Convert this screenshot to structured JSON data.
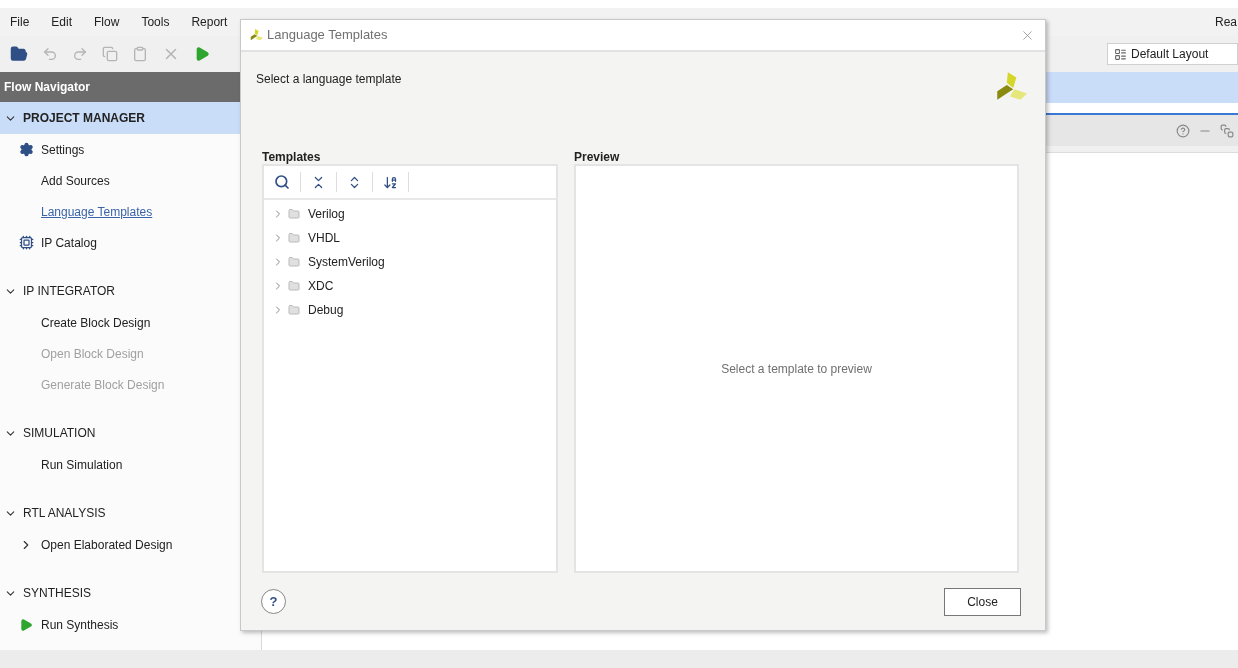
{
  "menu": [
    "File",
    "Edit",
    "Flow",
    "Tools",
    "Report"
  ],
  "top_right_text": "Rea",
  "layout_select": {
    "value": "Default Layout"
  },
  "navigator": {
    "title": "Flow Navigator",
    "sections": [
      {
        "title": "PROJECT MANAGER",
        "expanded": true,
        "selected": true,
        "items": [
          {
            "label": "Settings",
            "kind": "gear",
            "disabled": false
          },
          {
            "label": "Add Sources",
            "kind": "plain",
            "disabled": false
          },
          {
            "label": "Language Templates",
            "kind": "link",
            "disabled": false
          },
          {
            "label": "IP Catalog",
            "kind": "chip",
            "disabled": false
          }
        ]
      },
      {
        "title": "IP INTEGRATOR",
        "expanded": true,
        "selected": false,
        "items": [
          {
            "label": "Create Block Design",
            "kind": "plain",
            "disabled": false
          },
          {
            "label": "Open Block Design",
            "kind": "plain",
            "disabled": true
          },
          {
            "label": "Generate Block Design",
            "kind": "plain",
            "disabled": true
          }
        ]
      },
      {
        "title": "SIMULATION",
        "expanded": true,
        "selected": false,
        "items": [
          {
            "label": "Run Simulation",
            "kind": "plain",
            "disabled": false
          }
        ]
      },
      {
        "title": "RTL ANALYSIS",
        "expanded": true,
        "selected": false,
        "items": [
          {
            "label": "Open Elaborated Design",
            "kind": "expandable",
            "disabled": false
          }
        ]
      },
      {
        "title": "SYNTHESIS",
        "expanded": true,
        "selected": false,
        "items": [
          {
            "label": "Run Synthesis",
            "kind": "play",
            "disabled": false
          }
        ]
      }
    ]
  },
  "dialog": {
    "title": "Language Templates",
    "subtitle": "Select a language template",
    "templates": {
      "label": "Templates",
      "items": [
        {
          "label": "Verilog",
          "expanded": false
        },
        {
          "label": "VHDL",
          "expanded": false
        },
        {
          "label": "SystemVerilog",
          "expanded": false
        },
        {
          "label": "XDC",
          "expanded": false
        },
        {
          "label": "Debug",
          "expanded": false
        }
      ]
    },
    "preview": {
      "label": "Preview",
      "message": "Select a template to preview"
    },
    "help_button": "?",
    "close_button": "Close"
  }
}
